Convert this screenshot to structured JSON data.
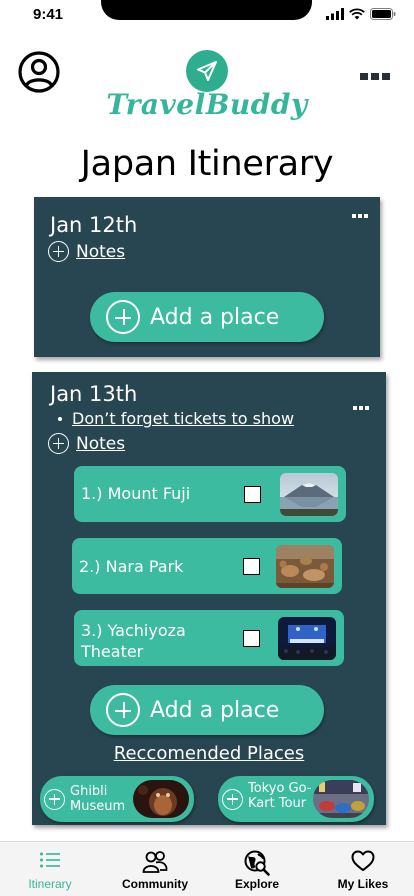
{
  "status": {
    "time": "9:41"
  },
  "header": {
    "logo_text": "TravelBuddy"
  },
  "page_title": "Japan Itinerary",
  "days": [
    {
      "date": "Jan 12th",
      "notes_label": "Notes",
      "add_place_label": "Add a place"
    },
    {
      "date": "Jan 13th",
      "reminder": "Don’t forget tickets to show",
      "notes_label": "Notes",
      "places": [
        {
          "label": "1.)  Mount Fuji",
          "checked": false,
          "image": "mount-fuji-lake"
        },
        {
          "label": "2.) Nara Park",
          "checked": false,
          "image": "nara-park-deer"
        },
        {
          "label": "3.) Yachiyoza Theater",
          "line1": "3.) Yachiyoza",
          "line2": "Theater",
          "checked": false,
          "image": "theater-stage"
        }
      ],
      "add_place_label": "Add a place",
      "recommended_title": "Reccomended Places",
      "recommended": [
        {
          "line1": "Ghibli",
          "line2": "Museum",
          "image": "ghibli-totoro"
        },
        {
          "line1": "Tokyo Go-",
          "line2": "Kart Tour",
          "image": "go-kart-street"
        }
      ]
    }
  ],
  "tabs": [
    {
      "label": "Itinerary",
      "icon": "list-icon",
      "active": true
    },
    {
      "label": "Community",
      "icon": "people-icon",
      "active": false
    },
    {
      "label": "Explore",
      "icon": "globe-search-icon",
      "active": false
    },
    {
      "label": "My Likes",
      "icon": "heart-icon",
      "active": false
    }
  ],
  "colors": {
    "card_bg": "#284651",
    "accent": "#3dbba1",
    "logo": "#2fae8f",
    "active_tab": "#35b69a"
  }
}
